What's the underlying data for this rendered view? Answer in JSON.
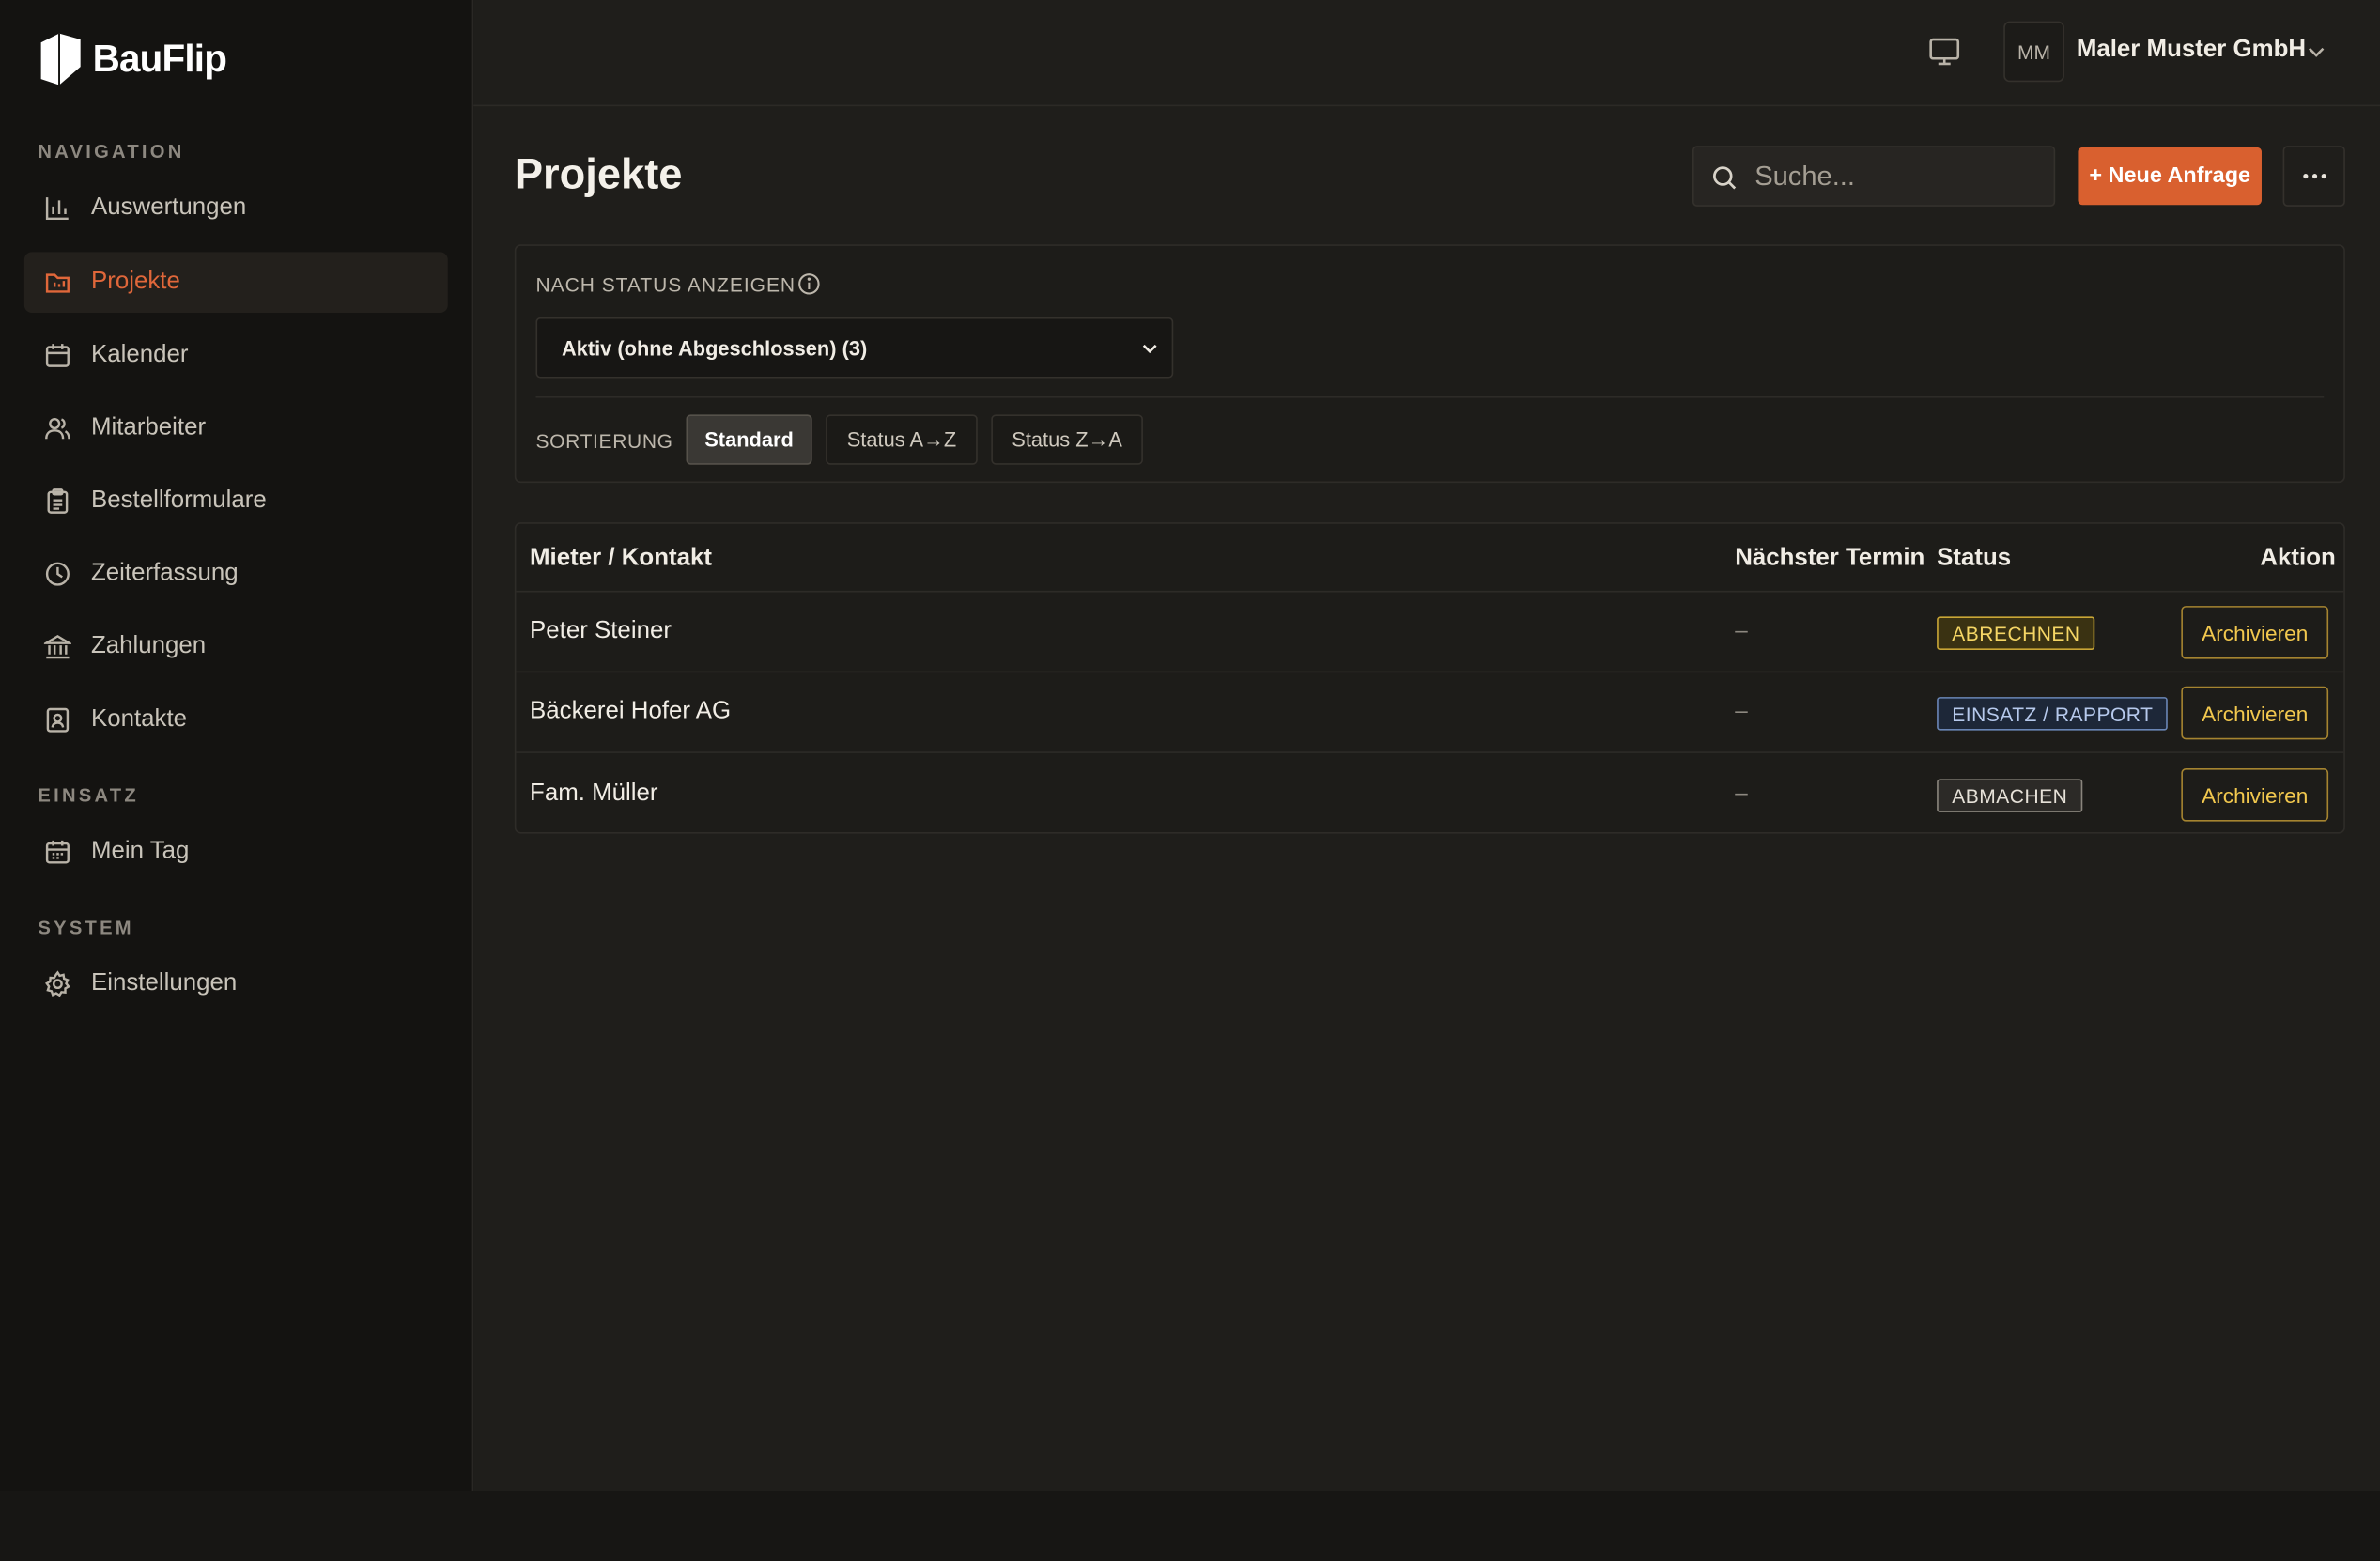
{
  "app": {
    "name": "BauFlip"
  },
  "sidebar": {
    "sections": [
      {
        "title": "NAVIGATION"
      },
      {
        "title": "EINSATZ"
      },
      {
        "title": "SYSTEM"
      }
    ],
    "items": [
      {
        "label": "Auswertungen",
        "icon": "bar-chart-icon"
      },
      {
        "label": "Projekte",
        "icon": "folder-icon",
        "active": true
      },
      {
        "label": "Kalender",
        "icon": "calendar-icon"
      },
      {
        "label": "Mitarbeiter",
        "icon": "users-icon"
      },
      {
        "label": "Bestellformulare",
        "icon": "clipboard-icon"
      },
      {
        "label": "Zeiterfassung",
        "icon": "clock-icon"
      },
      {
        "label": "Zahlungen",
        "icon": "bank-icon"
      },
      {
        "label": "Kontakte",
        "icon": "contact-icon"
      },
      {
        "label": "Mein Tag",
        "icon": "calendar-day-icon"
      },
      {
        "label": "Einstellungen",
        "icon": "gear-icon"
      }
    ]
  },
  "header": {
    "avatar_initials": "MM",
    "company": "Maler Muster GmbH"
  },
  "page": {
    "title": "Projekte",
    "search_placeholder": "Suche...",
    "new_button": "+ Neue Anfrage"
  },
  "filter": {
    "label": "NACH STATUS ANZEIGEN",
    "selected": "Aktiv (ohne Abgeschlossen) (3)",
    "sort_label": "SORTIERUNG",
    "sort_options": [
      "Standard",
      "Status A→Z",
      "Status Z→A"
    ],
    "sort_active": "Standard"
  },
  "table": {
    "headers": [
      "Mieter / Kontakt",
      "Nächster Termin",
      "Status",
      "Aktion"
    ],
    "rows": [
      {
        "name": "Peter Steiner",
        "next": "–",
        "status": "ABRECHNEN",
        "action": "Archivieren"
      },
      {
        "name": "Bäckerei Hofer AG",
        "next": "–",
        "status": "EINSATZ / RAPPORT",
        "action": "Archivieren"
      },
      {
        "name": "Fam. Müller",
        "next": "–",
        "status": "ABMACHEN",
        "action": "Archivieren"
      }
    ]
  },
  "colors": {
    "accent": "#d9602f",
    "status_yellow": "#f5d665",
    "status_blue": "#b6c9ec",
    "status_gray": "#e6e1d8"
  }
}
